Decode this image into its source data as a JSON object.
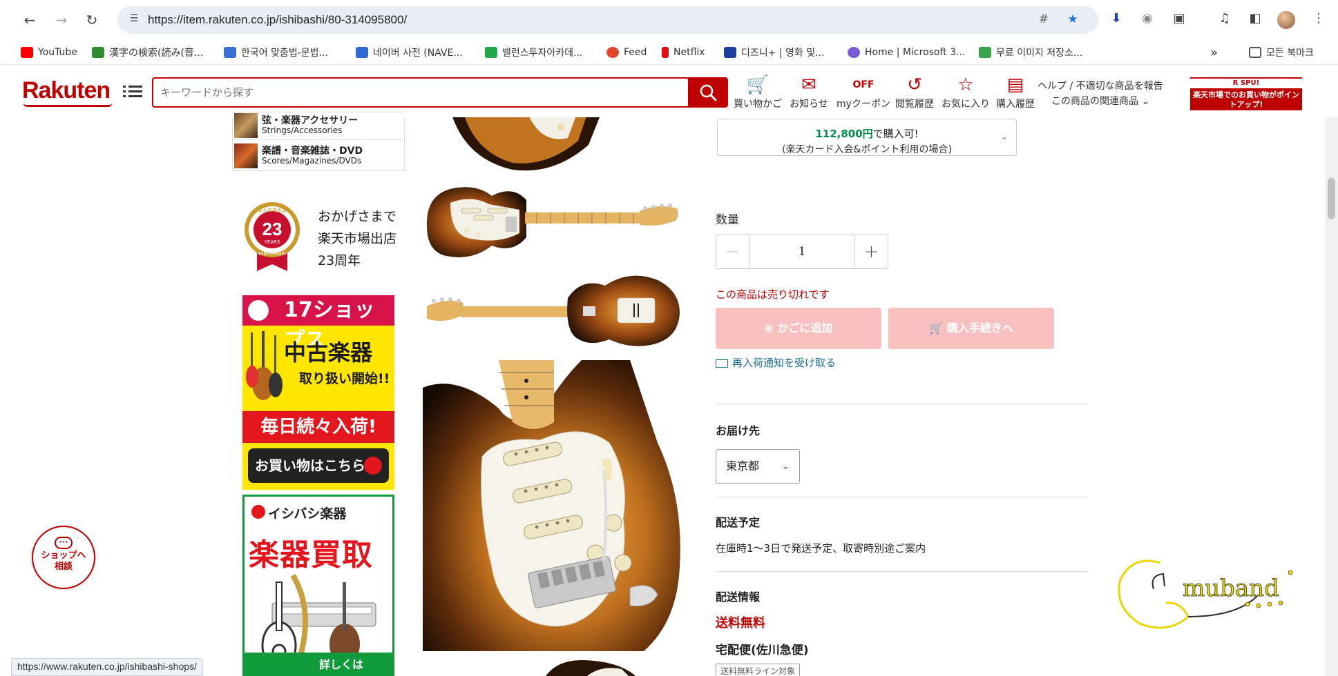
{
  "browser": {
    "url": "https://item.rakuten.co.jp/ishibashi/80-314095800/",
    "status_url": "https://www.rakuten.co.jp/ishibashi-shops/",
    "bookmarks": [
      {
        "label": "YouTube",
        "color": "#ff0000"
      },
      {
        "label": "漢字の検索(読み(音...",
        "color": "#2e8b2e"
      },
      {
        "label": "한국어 맞춤법-문법...",
        "color": "#3b6fd8"
      },
      {
        "label": "네이버 사전 (NAVE...",
        "color": "#2d6ad8"
      },
      {
        "label": "밸런스투자아카데...",
        "color": "#22a84a"
      },
      {
        "label": "Feed",
        "color": "#e0452b"
      },
      {
        "label": "Netflix",
        "color": "#e50914"
      },
      {
        "label": "디즈니+ | 영화 및...",
        "color": "#1c3f9e"
      },
      {
        "label": "Home | Microsoft 3...",
        "color": "#7a5ad8"
      },
      {
        "label": "무료 이미지 저장소...",
        "color": "#37a64a"
      }
    ],
    "all_bookmarks": "모든 북마크",
    "more_glyph": "»"
  },
  "header": {
    "logo": "Rakuten",
    "search_placeholder": "キーワードから探す",
    "icons": [
      {
        "label": "買い物かご",
        "icon": "cart-icon"
      },
      {
        "label": "お知らせ",
        "icon": "notice-icon"
      },
      {
        "label": "myクーポン",
        "icon": "coupon-icon"
      },
      {
        "label": "閲覧履歴",
        "icon": "history-icon"
      },
      {
        "label": "お気に入り",
        "icon": "star-icon"
      },
      {
        "label": "購入履歴",
        "icon": "receipt-icon"
      }
    ],
    "help_line1": "ヘルプ / 不適切な商品を報告",
    "help_line2": "この商品の関連商品",
    "spu_top": "R SPU!",
    "spu_text": "楽天市場でのお買い物がポイントアップ!"
  },
  "left": {
    "categories": [
      {
        "jp": "弦・楽器アクセサリー",
        "en": "Strings/Accessories"
      },
      {
        "jp": "楽譜・音楽雑誌・DVD",
        "en": "Scores/Magazines/DVDs"
      }
    ],
    "anniv_badge_top": "楽天市場出店",
    "anniv_number": "23",
    "anniv_years": "YEARS",
    "anniv_bottom": "ANNIVERSARY",
    "anniv_line1": "おかげさまで",
    "anniv_line2": "楽天市場出店",
    "anniv_line3": "23周年",
    "ad1": {
      "top": "17ショップス",
      "headline": "中古楽器",
      "headline2": "取り扱い開始!!",
      "redbar": "毎日続々入荷!",
      "button": "お買い物はこちら"
    },
    "ad2": {
      "brand": "イシバシ楽器",
      "big": "楽器買取",
      "detail": "詳しくは"
    }
  },
  "product": {
    "price_amount": "112,800円",
    "price_suffix": "で購入可!",
    "price_note": "(楽天カード入会&ポイント利用の場合)",
    "qty_label": "数量",
    "qty_value": "1",
    "minus": "−",
    "plus": "+",
    "soldout": "この商品は売り切れです",
    "cart_btn": "かごに追加",
    "buy_btn": "購入手続きへ",
    "restock": "再入荷通知を受け取る",
    "dest_title": "お届け先",
    "dest_value": "東京都",
    "schedule_title": "配送予定",
    "schedule_text": "在庫時1〜3日で発送予定、取寄時別途ご案内",
    "shipping_title": "配送情報",
    "free_shipping": "送料無料",
    "carrier": "宅配便(佐川急便)",
    "ship_tag": "送料無料ライン対象"
  },
  "floating": {
    "chat_line1": "ショップへ",
    "chat_line2": "相談",
    "watermark": "GomuBand"
  },
  "colors": {
    "brand": "#bf0000",
    "disabled_button": "#f8c0c0",
    "price_green": "#008a4b",
    "link": "#1a6e9a"
  }
}
